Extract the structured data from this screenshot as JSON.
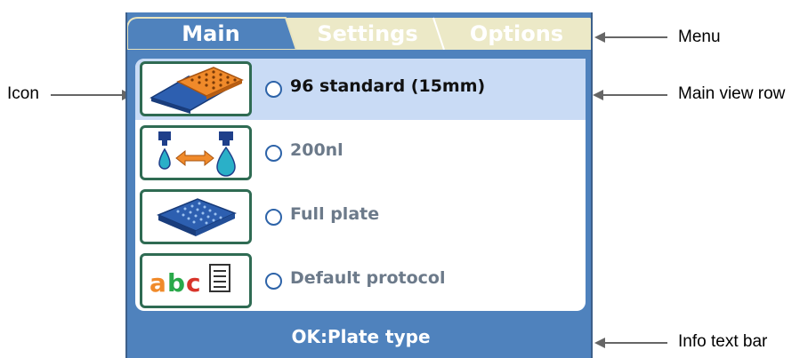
{
  "tabs": [
    {
      "label": "Main",
      "active": true
    },
    {
      "label": "Settings",
      "active": false
    },
    {
      "label": "Options",
      "active": false
    }
  ],
  "rows": [
    {
      "label": "96 standard (15mm)",
      "icon": "plate-icon",
      "selected": true
    },
    {
      "label": "200nl",
      "icon": "dispense-volume-icon",
      "selected": false
    },
    {
      "label": "Full plate",
      "icon": "full-plate-icon",
      "selected": false
    },
    {
      "label": "Default protocol",
      "icon": "protocol-abc-icon",
      "selected": false
    }
  ],
  "info_text": "OK:Plate type",
  "callouts": {
    "menu": "Menu",
    "icon": "Icon",
    "main_view_row": "Main view row",
    "info_text_bar": "Info text bar"
  },
  "colors": {
    "frame_blue": "#4f82bd",
    "selected_row": "#c9dbf5",
    "inactive_tab": "#ece9c7",
    "icon_border": "#2f6b53"
  }
}
